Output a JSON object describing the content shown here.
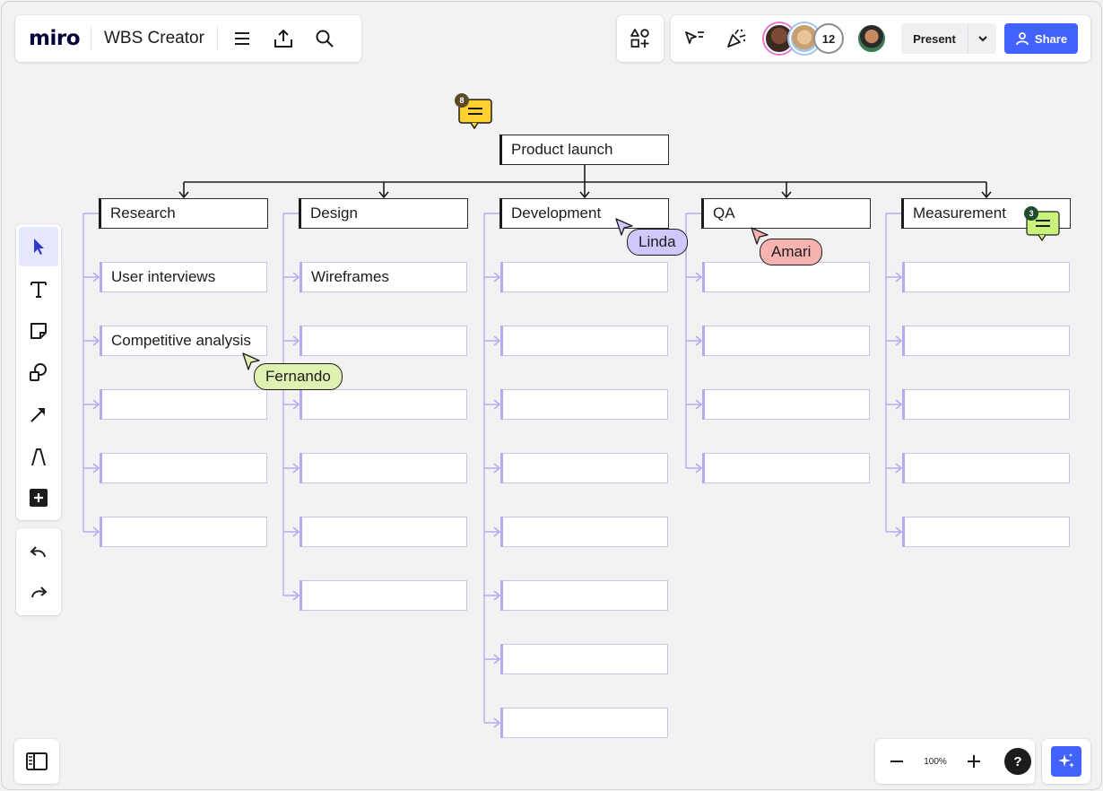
{
  "app": {
    "logo": "miro",
    "board_title": "WBS Creator",
    "collaborator_count": "12",
    "present_label": "Present",
    "share_label": "Share",
    "zoom_level": "100%",
    "help_label": "?"
  },
  "colors": {
    "accent": "#4262ff",
    "cursor_fernando": "#dff2b2",
    "cursor_linda": "#cfc8fb",
    "cursor_amari": "#f6b3b0",
    "comment_yellow": "#ffd02f",
    "comment_green": "#c9f27a"
  },
  "icons": {
    "menu": "hamburger-icon",
    "export": "upload-icon",
    "search": "search-icon",
    "apps": "shapes-plus-icon",
    "cursor_toggle": "cursor-lines-icon",
    "celebrate": "party-popper-icon",
    "share": "person-icon",
    "select": "pointer-icon",
    "text": "text-icon",
    "sticky": "sticky-note-icon",
    "shapes": "shapes-icon",
    "arrow": "arrow-icon",
    "pen": "pen-icon",
    "add": "plus-square-icon",
    "undo": "undo-icon",
    "redo": "redo-icon",
    "sidebar": "sidebar-icon",
    "zoom_out": "minus-icon",
    "zoom_in": "plus-icon",
    "ai": "sparkle-icon"
  },
  "wbs": {
    "root": "Product launch",
    "columns": [
      {
        "title": "Research",
        "items": [
          "User interviews",
          "Competitive analysis",
          "",
          "",
          ""
        ]
      },
      {
        "title": "Design",
        "items": [
          "Wireframes",
          "",
          "",
          "",
          "",
          ""
        ]
      },
      {
        "title": "Development",
        "items": [
          "",
          "",
          "",
          "",
          "",
          "",
          "",
          ""
        ]
      },
      {
        "title": "QA",
        "items": [
          "",
          "",
          "",
          ""
        ]
      },
      {
        "title": "Measurement",
        "items": [
          "",
          "",
          "",
          "",
          ""
        ]
      }
    ]
  },
  "cursors": [
    {
      "name": "Fernando"
    },
    {
      "name": "Linda"
    },
    {
      "name": "Amari"
    }
  ],
  "comments": [
    {
      "count": "8"
    },
    {
      "count": "3"
    }
  ]
}
